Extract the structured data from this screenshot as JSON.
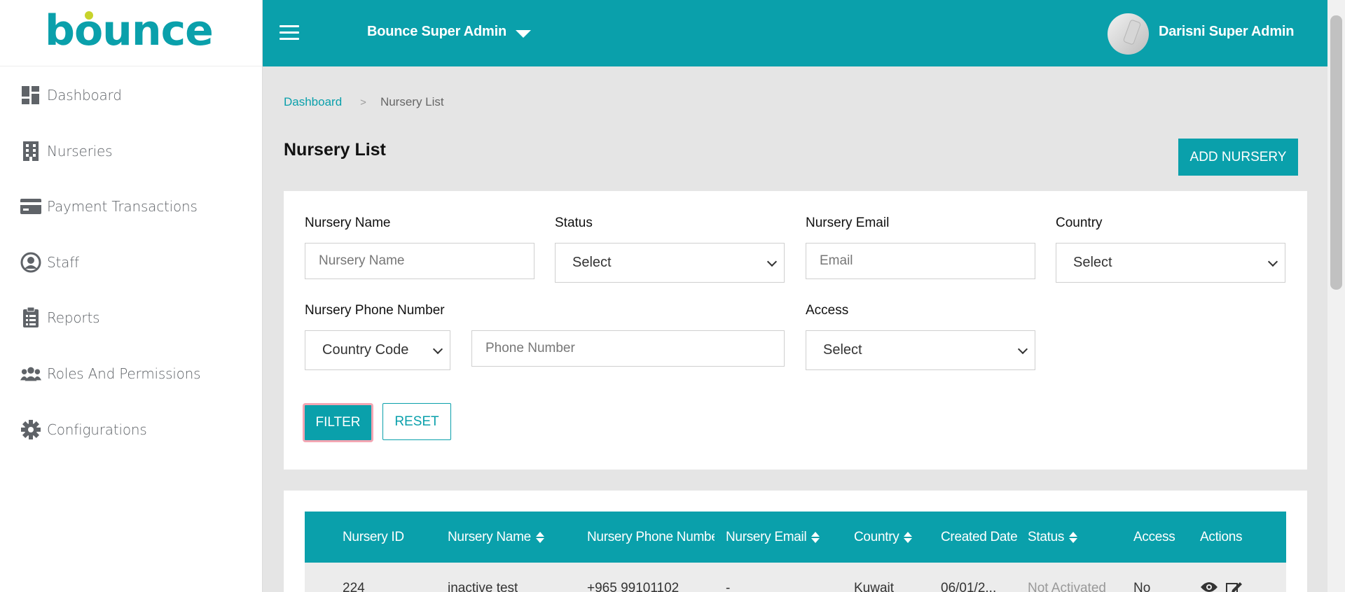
{
  "brand": {
    "logo_text": "bounce",
    "primary_color": "#0aa0ab",
    "accent_dot_color": "#c7d32b"
  },
  "sidebar": {
    "items": [
      {
        "label": "Dashboard",
        "icon": "dashboard-icon"
      },
      {
        "label": "Nurseries",
        "icon": "building-icon"
      },
      {
        "label": "Payment Transactions",
        "icon": "credit-card-icon"
      },
      {
        "label": "Staff",
        "icon": "user-circle-icon"
      },
      {
        "label": "Reports",
        "icon": "clipboard-list-icon"
      },
      {
        "label": "Roles And Permissions",
        "icon": "users-icon"
      },
      {
        "label": "Configurations",
        "icon": "gear-icon"
      }
    ]
  },
  "topbar": {
    "title": "Bounce Super Admin",
    "user_name": "Darisni Super Admin"
  },
  "breadcrumb": {
    "home": "Dashboard",
    "separator": ">",
    "current": "Nursery List"
  },
  "page": {
    "title": "Nursery List",
    "add_button": "ADD NURSERY"
  },
  "filters": {
    "nursery_name": {
      "label": "Nursery Name",
      "placeholder": "Nursery Name"
    },
    "status": {
      "label": "Status",
      "value": "Select"
    },
    "nursery_email": {
      "label": "Nursery Email",
      "placeholder": "Email"
    },
    "country": {
      "label": "Country",
      "value": "Select"
    },
    "phone": {
      "label": "Nursery Phone Number",
      "country_code": "Country Code",
      "placeholder": "Phone Number"
    },
    "access": {
      "label": "Access",
      "value": "Select"
    },
    "filter_button": "FILTER",
    "reset_button": "RESET"
  },
  "table": {
    "columns": [
      "Nursery ID",
      "Nursery Name",
      "Nursery Phone Number",
      "Nursery Email",
      "Country",
      "Created Date",
      "Status",
      "Access",
      "Actions"
    ],
    "rows": [
      {
        "id": "224",
        "name": "inactive test",
        "phone": "+965 99101102",
        "email": "-",
        "country": "Kuwait",
        "created": "06/01/2...",
        "status": "Not Activated",
        "access": "No"
      }
    ]
  }
}
